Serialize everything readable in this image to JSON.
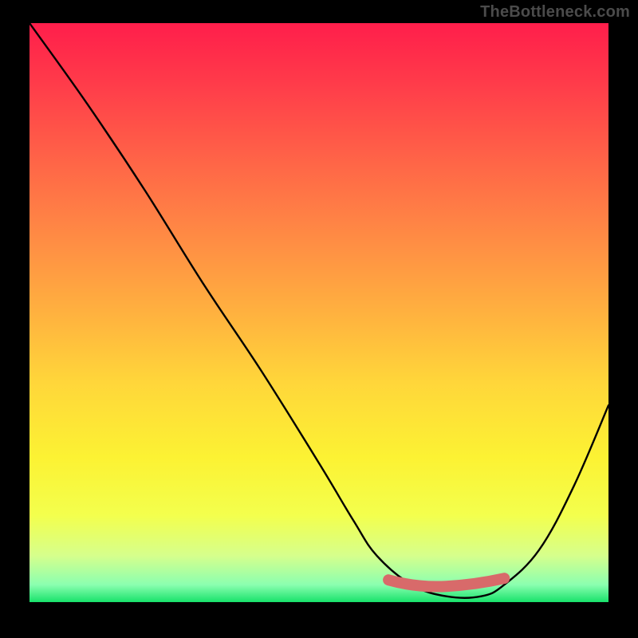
{
  "watermark": "TheBottleneck.com",
  "chart_data": {
    "type": "line",
    "title": "",
    "xlabel": "",
    "ylabel": "",
    "xlim": [
      0,
      100
    ],
    "ylim": [
      0,
      100
    ],
    "series": [
      {
        "name": "bottleneck-curve",
        "x": [
          0,
          10,
          20,
          30,
          40,
          50,
          56,
          60,
          66,
          72,
          78,
          82,
          88,
          94,
          100
        ],
        "values": [
          100,
          86,
          71,
          55,
          40,
          24,
          14,
          8,
          3,
          1,
          1,
          3,
          9,
          20,
          34
        ]
      }
    ],
    "highlight": {
      "name": "optimal-zone",
      "x_start": 62,
      "x_end": 82,
      "y": 3
    },
    "gradient_stops": [
      {
        "pos": 0,
        "color": "#ff1e4b"
      },
      {
        "pos": 25,
        "color": "#ff6847"
      },
      {
        "pos": 50,
        "color": "#ffb13f"
      },
      {
        "pos": 75,
        "color": "#fcf233"
      },
      {
        "pos": 100,
        "color": "#18e26b"
      }
    ]
  }
}
